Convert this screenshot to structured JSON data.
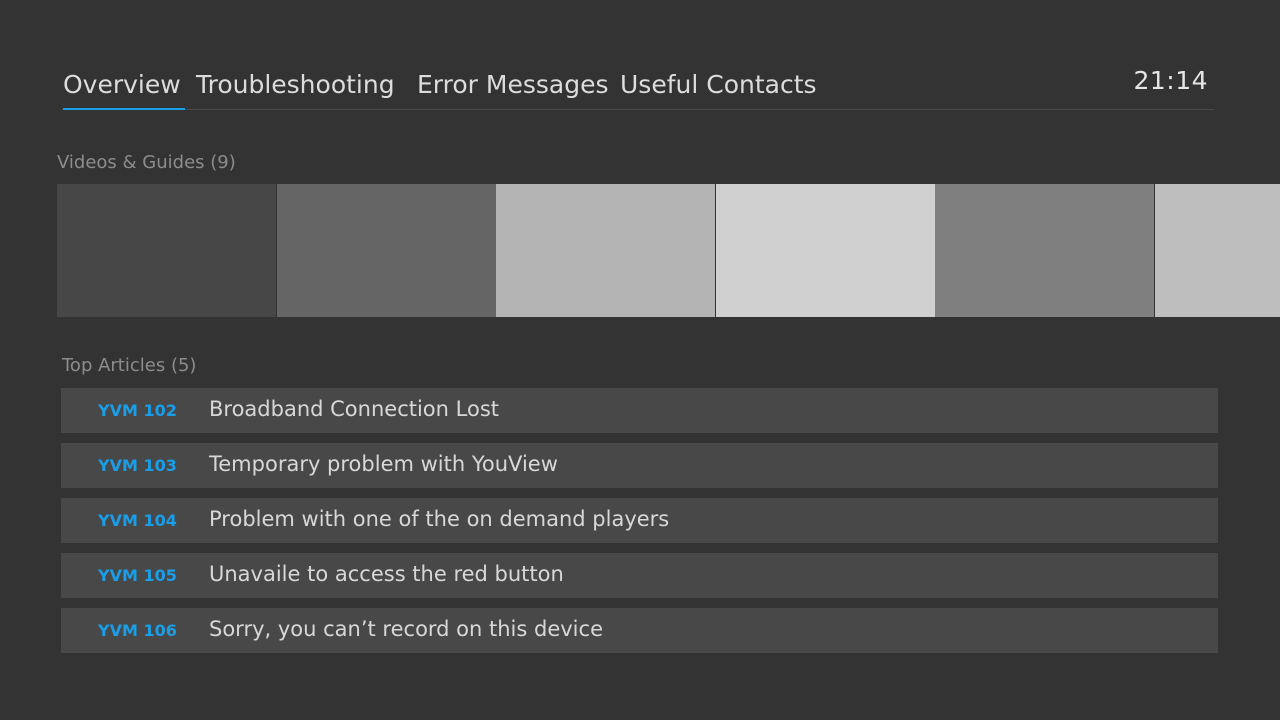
{
  "nav": {
    "tabs": [
      {
        "label": "Overview",
        "active": true
      },
      {
        "label": "Troubleshooting",
        "active": false
      },
      {
        "label": "Error Messages",
        "active": false
      },
      {
        "label": "Useful Contacts",
        "active": false
      }
    ],
    "clock": "21:14"
  },
  "videos": {
    "heading": "Videos & Guides (9)",
    "tiles": [
      {
        "color": "#484747"
      },
      {
        "color": "#666565"
      },
      {
        "color": "#b5b4b4"
      },
      {
        "color": "#d1d0d0"
      },
      {
        "color": "#807f7f"
      },
      {
        "color": "#bfbebe"
      }
    ]
  },
  "articles": {
    "heading": "Top Articles (5)",
    "items": [
      {
        "code": "YVM 102",
        "title": "Broadband Connection Lost"
      },
      {
        "code": "YVM 103",
        "title": "Temporary problem with YouView"
      },
      {
        "code": "YVM 104",
        "title": "Problem with one of the on demand players"
      },
      {
        "code": "YVM 105",
        "title": "Unavaile to access the red button"
      },
      {
        "code": "YVM 106",
        "title": "Sorry, you can’t record on this device"
      }
    ]
  },
  "colors": {
    "accent": "#1a9ee8",
    "background": "#333333",
    "row": "#484848"
  }
}
